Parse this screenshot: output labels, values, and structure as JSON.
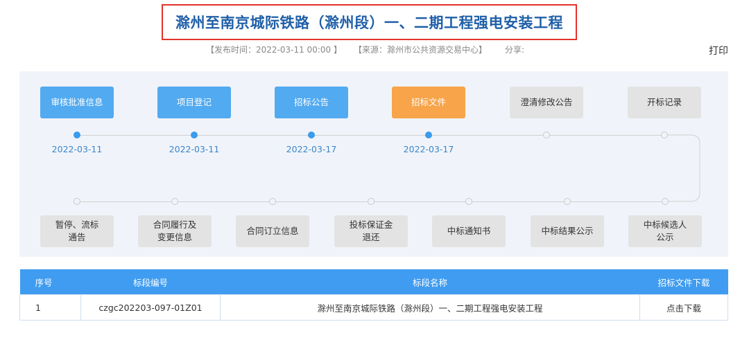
{
  "page": {
    "title": "滁州至南京城际铁路（滁州段）一、二期工程强电安装工程",
    "publish_time": "【发布时间：2022-03-11 00:00 】",
    "source": "【来源：滁州市公共资源交易中心】",
    "share": "分享:",
    "print": "打印"
  },
  "flow": {
    "top_steps": [
      {
        "label": "审核批准信息",
        "date": "2022-03-11",
        "state": "done"
      },
      {
        "label": "项目登记",
        "date": "2022-03-11",
        "state": "done"
      },
      {
        "label": "招标公告",
        "date": "2022-03-17",
        "state": "done"
      },
      {
        "label": "招标文件",
        "date": "2022-03-17",
        "state": "current"
      },
      {
        "label": "澄清修改公告",
        "date": "",
        "state": "pending"
      },
      {
        "label": "开标记录",
        "date": "",
        "state": "pending"
      }
    ],
    "bottom_steps": [
      {
        "label": "暂停、流标\n通告"
      },
      {
        "label": "合同履行及\n变更信息"
      },
      {
        "label": "合同订立信息"
      },
      {
        "label": "投标保证金\n退还"
      },
      {
        "label": "中标通知书"
      },
      {
        "label": "中标结果公示"
      },
      {
        "label": "中标候选人\n公示"
      }
    ],
    "colors": {
      "done": "#52aaf0",
      "current": "#f8a44a",
      "pending": "#e3e3e3"
    }
  },
  "table": {
    "headers": [
      "序号",
      "标段编号",
      "标段名称",
      "招标文件下载"
    ],
    "rows": [
      [
        "1",
        "czgc202203-097-01Z01",
        "滁州至南京城际铁路（滁州段）一、二期工程强电安装工程",
        "点击下载"
      ]
    ]
  }
}
